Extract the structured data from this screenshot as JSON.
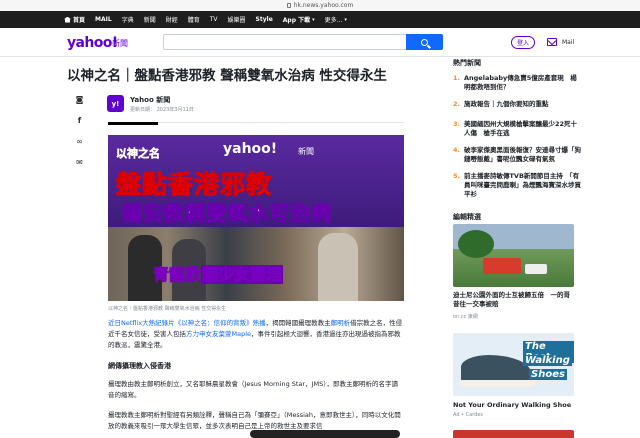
{
  "browser": {
    "url": "hk.news.yahoo.com"
  },
  "topnav": {
    "items": [
      "首頁",
      "MAIL",
      "字典",
      "新聞",
      "財經",
      "體育",
      "TV",
      "娛樂圈",
      "Style",
      "App 下載",
      "更多..."
    ]
  },
  "header": {
    "logo": "yahoo!",
    "logo_sub": "新聞",
    "search_placeholder": "",
    "login_label": "登入",
    "mail_label": "Mail"
  },
  "article": {
    "title": "以神之名｜盤點香港邪教 聲稱雙氧水治病 性交得永生",
    "source_logo": "y!",
    "source_name": "Yahoo 新聞",
    "updated": "更新日期： 2023年3月11日",
    "hero": {
      "brand": "yahoo!",
      "brand_sub": "新聞",
      "line1": "以神之名",
      "line2": "盤點香港邪教",
      "line3": "錫安教稱雙氧水可治病",
      "line4a": "青龍教",
      "line4b": "騙少女賣淫"
    },
    "caption": "以神之名｜盤點香港邪教 聲稱雙氧水治病 性交得永生",
    "p1_link1": "近日Netflix大熱紀錄片《以神之名：信仰的背叛》熱播",
    "p1_text1": "，揭開韓國攝理教教主",
    "p1_link2": "鄭明析",
    "p1_text2": "借宗教之名，性侵近千名女信徒，受害人包括",
    "p1_link3": "方力申女友葉萱Maple",
    "p1_text3": "，事件引起極大迴響，香港過往亦出現過被指為邪教的教派，震驚全港。",
    "h3": "網傳攝理教入侵香港",
    "p2": "攝理教由教主鄭明析創立，又名耶穌晨星教會（Jesus Morning Star，JMS），即教主鄭明析的名字讀音的縮寫。",
    "p3": "攝理教教主鄭明析對聖經有另類詮釋，聲稱自己為「彌賽亞」（Messiah，意即救世主），同時以文化開放的教義來吸引一眾大學生信眾，並多次表明自己是上帝的救世主及要求信"
  },
  "share_icons": [
    "whatsapp-icon",
    "facebook-icon",
    "link-icon",
    "email-icon"
  ],
  "sidebar": {
    "trending_title": "熱門新聞",
    "trending": [
      {
        "n": "1.",
        "text": "Angelababy傳急賣5億房產套現　楊明都救唔到佢？"
      },
      {
        "n": "2.",
        "text": "施政報告｜九個你要知的重點"
      },
      {
        "n": "3.",
        "text": "美國緬因州大規模槍擊案釀最少22死十人傷　槍手在逃"
      },
      {
        "n": "4.",
        "text": "破李家傑奧黑面後報復？安達尋寸爆「狗鏈嘢飯戴」書呢位飄女碌有氣氛"
      },
      {
        "n": "5.",
        "text": "前主播麥詩敏傳TVB新開節目主持　「有員叫咪臺完問鹿喇」為煙飄海寶深水埗買平衫"
      }
    ],
    "editor_title": "編輯精選",
    "card1_title": "迪士尼公園外面的士互被歸五倍　一的哥昔往一交事被賠",
    "card1_source": "on.cc 東網",
    "card2_ad_line1": "The Best",
    "card2_ad_line2": "Walking",
    "card2_ad_line3": "Shoes",
    "card2_title": "Not Your Ordinary Walking Shoe",
    "card2_source": "Ad • Cardes"
  }
}
